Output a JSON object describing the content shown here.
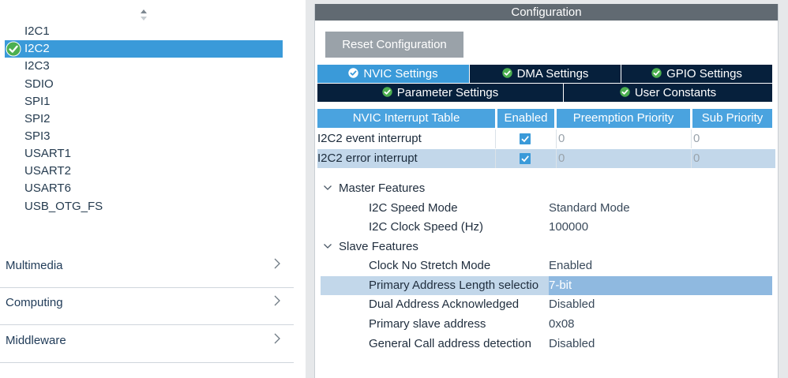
{
  "sidebar": {
    "peripherals": [
      "I2C1",
      "I2C2",
      "I2C3",
      "SDIO",
      "SPI1",
      "SPI2",
      "SPI3",
      "USART1",
      "USART2",
      "USART6",
      "USB_OTG_FS"
    ],
    "selected": "I2C2",
    "categories": [
      "Multimedia",
      "Computing",
      "Middleware"
    ]
  },
  "config": {
    "title": "Configuration",
    "reset_label": "Reset Configuration",
    "tabs_row1": [
      "NVIC Settings",
      "DMA Settings",
      "GPIO Settings"
    ],
    "tabs_row2": [
      "Parameter Settings",
      "User Constants"
    ],
    "active_tab": "NVIC Settings"
  },
  "nvic": {
    "headers": [
      "NVIC Interrupt Table",
      "Enabled",
      "Preemption Priority",
      "Sub Priority"
    ],
    "rows": [
      {
        "name": "I2C2 event interrupt",
        "enabled": true,
        "preemption": "0",
        "sub": "0"
      },
      {
        "name": "I2C2 error interrupt",
        "enabled": true,
        "preemption": "0",
        "sub": "0"
      }
    ]
  },
  "params": {
    "groups": [
      {
        "label": "Master Features",
        "items": [
          {
            "name": "I2C Speed Mode",
            "value": "Standard Mode"
          },
          {
            "name": "I2C Clock Speed (Hz)",
            "value": "100000"
          }
        ]
      },
      {
        "label": "Slave Features",
        "items": [
          {
            "name": "Clock No Stretch Mode",
            "value": "Enabled"
          },
          {
            "name": "Primary Address Length selectio",
            "value": "7-bit"
          },
          {
            "name": "Dual Address Acknowledged",
            "value": "Disabled"
          },
          {
            "name": "Primary slave address",
            "value": "0x08"
          },
          {
            "name": "General Call address detection",
            "value": "Disabled"
          }
        ]
      }
    ],
    "selected_item": "Primary Address Length selectio"
  },
  "colors": {
    "accent": "#3a9ad9",
    "tab_dark": "#06203c",
    "header_gray": "#616a72",
    "check_green": "#4caf50"
  }
}
